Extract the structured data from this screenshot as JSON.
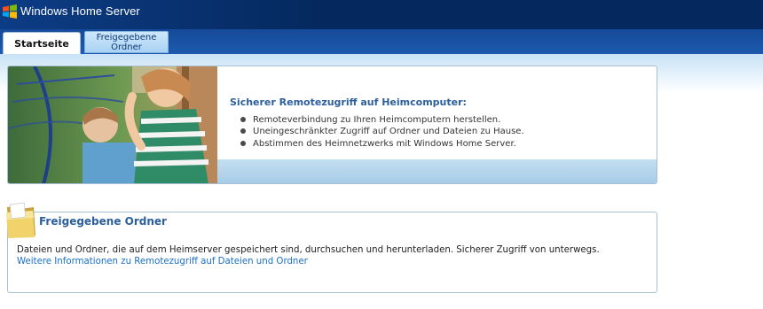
{
  "app": {
    "title": "Windows Home Server",
    "logo_icon": "windows-flag-icon"
  },
  "tabs": [
    {
      "label": "Startseite",
      "active": true
    },
    {
      "label_line1": "Freigegebene",
      "label_line2": "Ordner",
      "active": false
    }
  ],
  "remote_panel": {
    "title": "Sicherer Remotezugriff auf Heimcomputer:",
    "image": "family-on-swing-photo",
    "bullets": [
      "Remoteverbindung zu Ihren Heimcomputern herstellen.",
      "Uneingeschränkter Zugriff auf Ordner und Dateien zu Hause.",
      "Abstimmen des Heimnetzwerks mit Windows Home Server."
    ]
  },
  "shared_folders_panel": {
    "icon": "folder-icon",
    "title": "Freigegebene Ordner",
    "description": "Dateien und Ordner, die auf dem Heimserver gespeichert sind, durchsuchen und herunterladen. Sicherer Zugriff von unterwegs.",
    "link": "Weitere Informationen zu Remotezugriff auf Dateien und Ordner"
  },
  "colors": {
    "header_bg": "#05295e",
    "accent_title": "#2c5f9e",
    "link": "#1a6fc9",
    "panel_border": "#a8c0d6"
  }
}
